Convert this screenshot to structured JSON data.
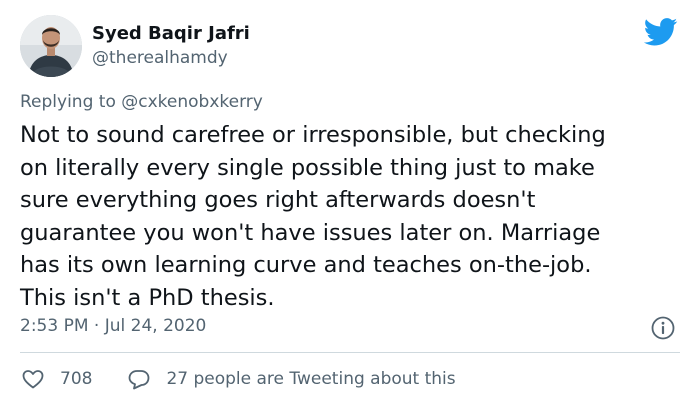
{
  "author": {
    "display_name": "Syed Baqir Jafri",
    "handle": "@therealhamdy"
  },
  "reply": {
    "prefix": "Replying to ",
    "mention": "@cxkenobxkerry"
  },
  "tweet": {
    "text": "Not to sound carefree or irresponsible, but checking\non literally every single possible thing just to make\nsure everything goes right afterwards doesn't\nguarantee you won't have issues later on. Marriage\nhas its own learning curve and teaches on-the-job.\nThis isn't a PhD thesis.",
    "timestamp": "2:53 PM · Jul 24, 2020"
  },
  "actions": {
    "likes": "708",
    "conversation": "27 people are Tweeting about this"
  },
  "icons": {
    "brand": "twitter-bird-icon",
    "info": "info-icon",
    "like": "heart-icon",
    "reply": "speech-bubble-icon"
  },
  "colors": {
    "brand": "#1d9bf0",
    "text": "#0f1419",
    "secondary": "#536471",
    "divider": "#cfd9de"
  }
}
